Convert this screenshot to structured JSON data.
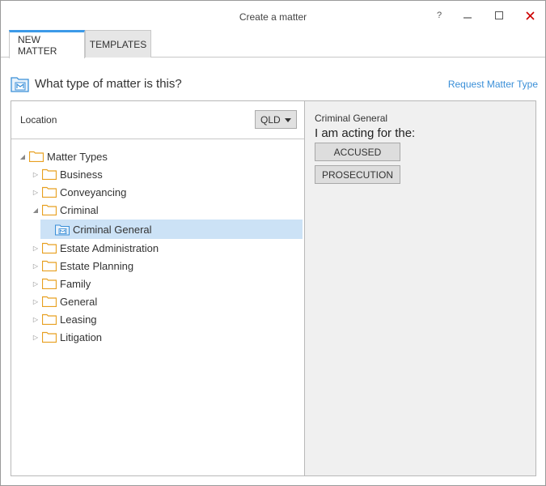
{
  "window": {
    "title": "Create a matter",
    "controls": {
      "help": "?",
      "minimize": "–",
      "maximize": "☐",
      "close": "✕"
    },
    "close_color": "#cc0000"
  },
  "tabs": [
    {
      "label": "NEW MATTER",
      "active": true
    },
    {
      "label": "TEMPLATES",
      "active": false
    }
  ],
  "question": {
    "text": "What type of matter is this?",
    "icon": "matter-icon",
    "request_link": "Request Matter Type"
  },
  "location": {
    "label": "Location",
    "selected": "QLD"
  },
  "tree": {
    "root": {
      "label": "Matter Types",
      "expanded": true
    },
    "items": [
      {
        "label": "Business",
        "expanded": false
      },
      {
        "label": "Conveyancing",
        "expanded": false
      },
      {
        "label": "Criminal",
        "expanded": true
      },
      {
        "label": "Criminal General",
        "selected": true,
        "icon": "matter-icon"
      },
      {
        "label": "Estate Administration",
        "expanded": false
      },
      {
        "label": "Estate Planning",
        "expanded": false
      },
      {
        "label": "Family",
        "expanded": false
      },
      {
        "label": "General",
        "expanded": false
      },
      {
        "label": "Leasing",
        "expanded": false
      },
      {
        "label": "Litigation",
        "expanded": false
      }
    ]
  },
  "detail": {
    "title": "Criminal General",
    "acting_for": "I am acting for the:",
    "options": [
      "ACCUSED",
      "PROSECUTION"
    ]
  },
  "colors": {
    "accent": "#3c9ae8",
    "link": "#3a8fd8",
    "folder": "#e8a020",
    "selection": "#cce2f6"
  }
}
